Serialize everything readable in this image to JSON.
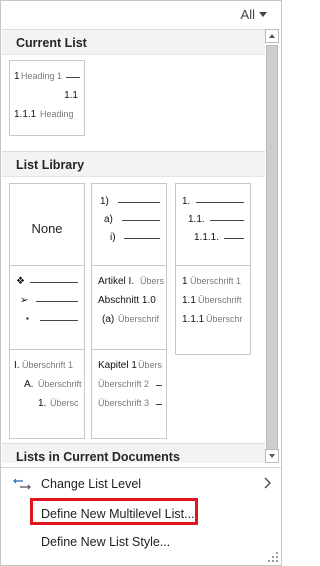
{
  "filter": {
    "label": "All"
  },
  "sections": {
    "current_list": "Current List",
    "list_library": "List Library",
    "lists_in_documents": "Lists in Current Documents"
  },
  "current_list": {
    "row1_num": "1",
    "row1_text": "Heading 1",
    "row2_num": "1.1",
    "row3_num": "1.1.1",
    "row3_text": "Heading"
  },
  "library": {
    "none_label": "None",
    "numeric": [
      "1)",
      "a)",
      "i)"
    ],
    "decimal": [
      "1.",
      "1.1.",
      "1.1.1."
    ],
    "bullets": [
      "❖",
      "➢",
      "▪"
    ],
    "article": {
      "row1_num": "Artikel I.",
      "row1_text": "Übers",
      "row2_num": "Abschnitt 1.0",
      "row3_num": "(a)",
      "row3_text": "Überschrif"
    },
    "heading_decimal": {
      "row1_num": "1",
      "row1_text": "Überschrift 1",
      "row2_num": "1.1",
      "row2_text": "Überschrift",
      "row3_num": "1.1.1",
      "row3_text": "Überschr"
    },
    "roman": {
      "row1_num": "I.",
      "row1_text": "Überschrift 1",
      "row2_num": "A.",
      "row2_text": "Überschrift",
      "row3_num": "1.",
      "row3_text": "Übersc"
    },
    "chapter": {
      "row1_num": "Kapitel 1",
      "row1_text": "Übers",
      "row2_text": "Überschrift 2",
      "row3_text": "Überschrift 3"
    }
  },
  "menu": {
    "change_level": "Change List Level",
    "define_multilevel": "Define New Multilevel List...",
    "define_style": "Define New List Style..."
  },
  "colors": {
    "highlight": "#e0161e",
    "header_bg": "#f3f3f3"
  }
}
